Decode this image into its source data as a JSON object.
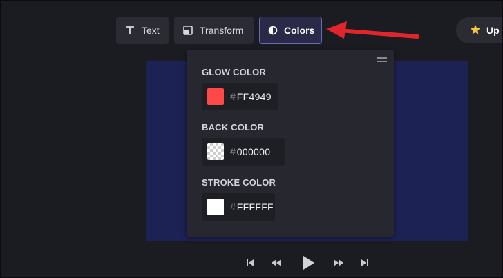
{
  "toolbar": {
    "text_label": "Text",
    "transform_label": "Transform",
    "colors_label": "Colors",
    "upgrade_label": "Up"
  },
  "color_panel": {
    "glow": {
      "label": "GLOW COLOR",
      "hash": "#",
      "value": "FF4949",
      "swatch": "#FF4949"
    },
    "back": {
      "label": "BACK COLOR",
      "hash": "#",
      "value": "000000",
      "swatch": "transparent"
    },
    "stroke": {
      "label": "STROKE COLOR",
      "hash": "#",
      "value": "FFFFFF",
      "swatch": "#FFFFFF"
    }
  },
  "icons": {
    "text": "text-icon",
    "transform": "transform-icon",
    "colors": "contrast-icon",
    "upgrade": "star-icon",
    "panel_handle": "drag-handle-icon",
    "playback": [
      "skip-start-icon",
      "rewind-icon",
      "play-icon",
      "fast-forward-icon",
      "skip-end-icon"
    ]
  },
  "colors": {
    "background": "#1b1b22",
    "canvas": "#1c2254",
    "accent_border": "#6a68b8",
    "arrow": "#e0262b"
  }
}
